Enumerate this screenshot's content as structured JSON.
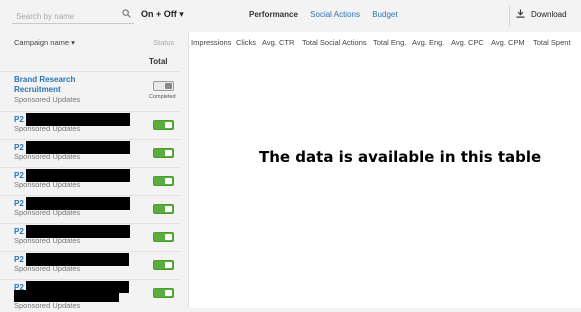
{
  "search": {
    "placeholder": "Search by name"
  },
  "filter": {
    "label": "On + Off ▾"
  },
  "tabs": [
    "Performance",
    "Social Actions",
    "Budget"
  ],
  "download": {
    "label": "Download"
  },
  "left_header": {
    "name": "Campaign name ▾",
    "status": "Status"
  },
  "total": {
    "label": "Total"
  },
  "campaigns": [
    {
      "title_line1": "Brand Research",
      "title_line2": "Recruitment",
      "type": "Sponsored Updates",
      "status": "off",
      "status_text": "Completed"
    },
    {
      "title_line1": "P2",
      "type": "Sponsored Updates",
      "status": "on"
    },
    {
      "title_line1": "P2",
      "type": "Sponsored Updates",
      "status": "on"
    },
    {
      "title_line1": "P2",
      "type": "Sponsored Updates",
      "status": "on"
    },
    {
      "title_line1": "P2",
      "type": "Sponsored Updates",
      "status": "on"
    },
    {
      "title_line1": "P2",
      "type": "Sponsored Updates",
      "status": "on"
    },
    {
      "title_line1": "P2",
      "type": "Sponsored Updates",
      "status": "on"
    },
    {
      "title_line1": "P2",
      "type": "Sponsored Updates",
      "status": "on"
    }
  ],
  "columns": [
    "Impressions",
    "Clicks",
    "Avg. CTR",
    "Total Social Actions",
    "Total Eng.",
    "Avg. Eng.",
    "Avg. CPC",
    "Avg. CPM",
    "Total Spent"
  ],
  "overlay_text": "The data is available in this table",
  "colors": {
    "link": "#2a74b7",
    "toggle_on": "#5cac3f",
    "bg": "#f3f3f3",
    "panel": "#ffffff"
  }
}
